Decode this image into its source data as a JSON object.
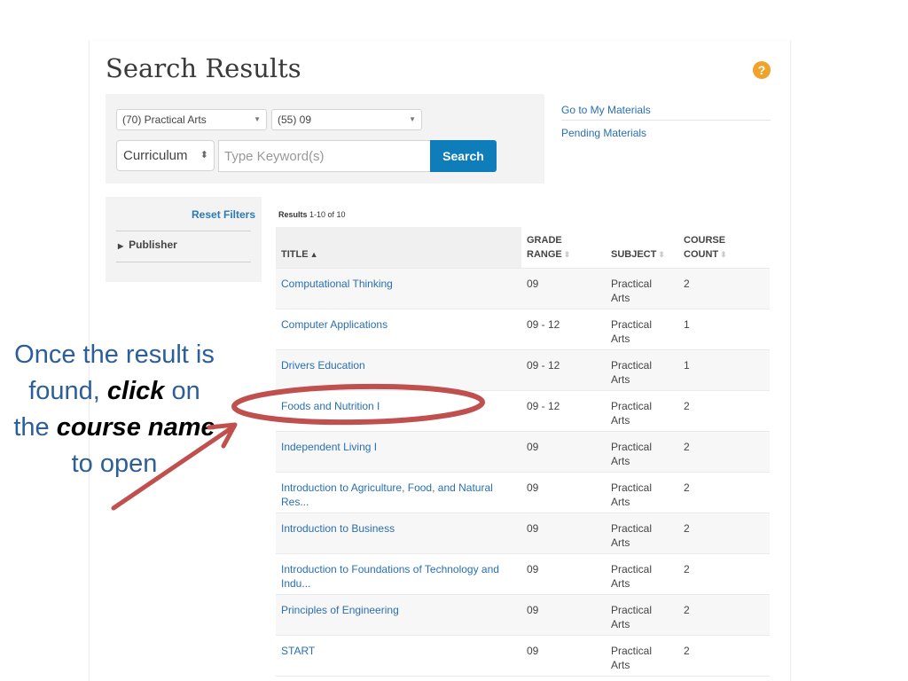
{
  "header": {
    "title": "Search Results",
    "help_icon": "question-circle-icon"
  },
  "search": {
    "subject_select": "(70) Practical Arts",
    "grade_select": "(55) 09",
    "type_select": "Curriculum",
    "keyword_value": "",
    "keyword_placeholder": "Type Keyword(s)",
    "search_label": "Search"
  },
  "side_links": {
    "my_materials": "Go to My Materials",
    "pending_materials": "Pending Materials"
  },
  "filters": {
    "reset_label": "Reset Filters",
    "groups": [
      {
        "label": "Publisher",
        "expanded": false
      }
    ]
  },
  "results": {
    "count_prefix": "Results",
    "count_range": "1-10 of 10",
    "columns": [
      {
        "line1": "",
        "line2": "TITLE",
        "sort": "asc"
      },
      {
        "line1": "GRADE",
        "line2": "RANGE",
        "sort": "none"
      },
      {
        "line1": "",
        "line2": "SUBJECT",
        "sort": "none"
      },
      {
        "line1": "COURSE",
        "line2": "COUNT",
        "sort": "none"
      }
    ],
    "rows": [
      {
        "title": "Computational Thinking",
        "grade": "09",
        "subject_1": "Practical",
        "subject_2": "Arts",
        "count": "2"
      },
      {
        "title": "Computer Applications",
        "grade": "09 - 12",
        "subject_1": "Practical",
        "subject_2": "Arts",
        "count": "1"
      },
      {
        "title": "Drivers Education",
        "grade": "09 - 12",
        "subject_1": "Practical",
        "subject_2": "Arts",
        "count": "1"
      },
      {
        "title": "Foods and Nutrition I",
        "grade": "09 - 12",
        "subject_1": "Practical",
        "subject_2": "Arts",
        "count": "2"
      },
      {
        "title": "Independent Living I",
        "grade": "09",
        "subject_1": "Practical",
        "subject_2": "Arts",
        "count": "2"
      },
      {
        "title": "Introduction to Agriculture, Food, and Natural Res...",
        "grade": "09",
        "subject_1": "Practical",
        "subject_2": "Arts",
        "count": "2"
      },
      {
        "title": "Introduction to Business",
        "grade": "09",
        "subject_1": "Practical",
        "subject_2": "Arts",
        "count": "2"
      },
      {
        "title": "Introduction to Foundations of Technology and Indu...",
        "grade": "09",
        "subject_1": "Practical",
        "subject_2": "Arts",
        "count": "2"
      },
      {
        "title": "Principles of Engineering",
        "grade": "09",
        "subject_1": "Practical",
        "subject_2": "Arts",
        "count": "2"
      },
      {
        "title": "START",
        "grade": "09",
        "subject_1": "Practical",
        "subject_2": "Arts",
        "count": "2"
      }
    ]
  },
  "annotation": {
    "part1": "Once the result is found, ",
    "emph1": "click",
    "part2": " on the ",
    "emph2": "course name",
    "part3": " to open",
    "highlight_row_index": 3,
    "color": "#c0504d"
  }
}
